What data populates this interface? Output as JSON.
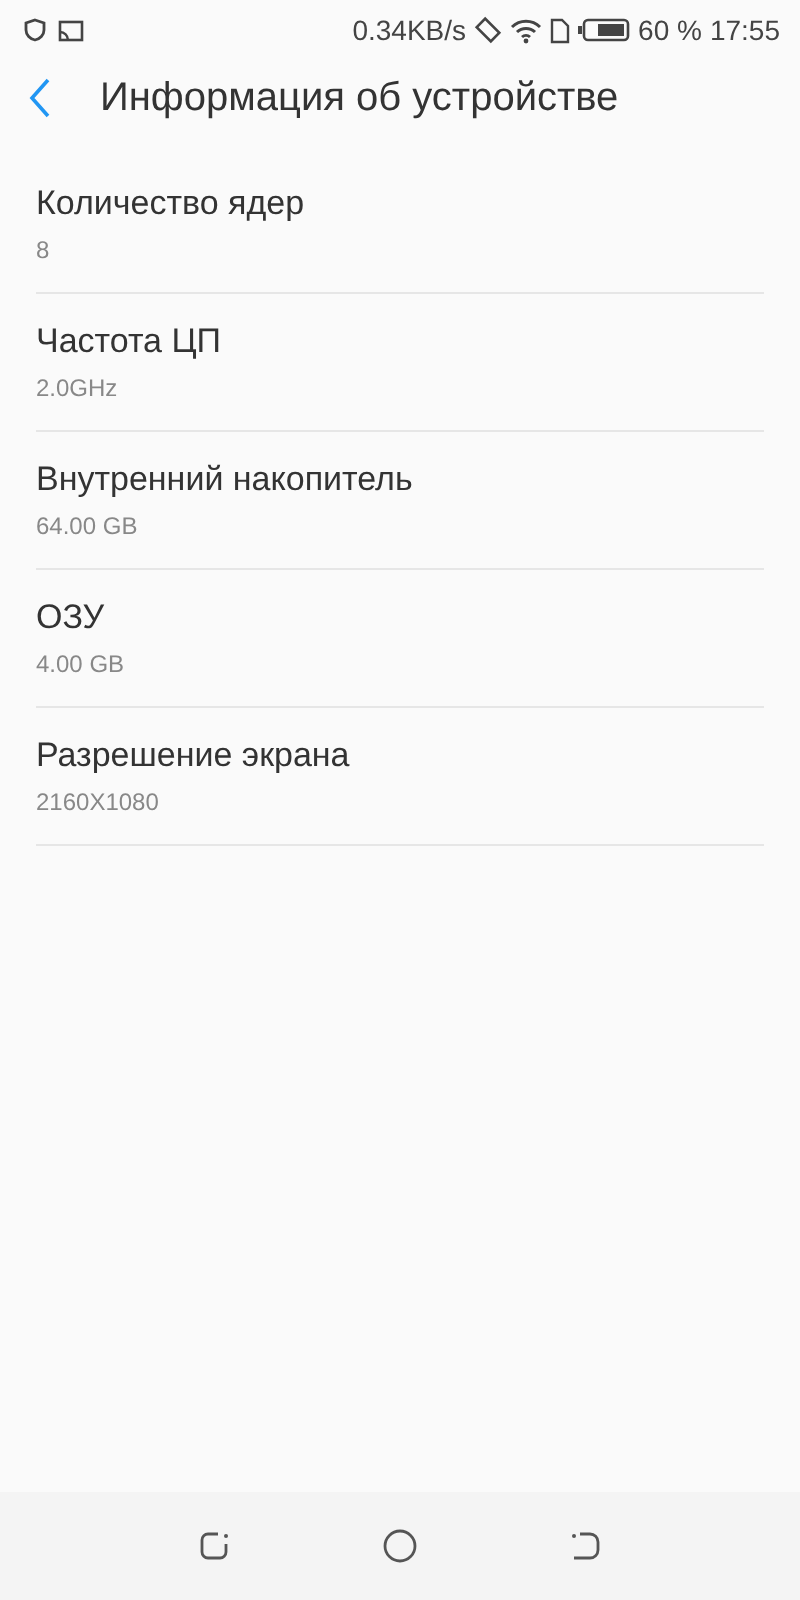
{
  "status_bar": {
    "speed": "0.34KB/s",
    "battery": "60 %",
    "time": "17:55"
  },
  "header": {
    "title": "Информация об устройстве"
  },
  "items": [
    {
      "label": "Количество ядер",
      "value": "8"
    },
    {
      "label": "Частота ЦП",
      "value": "2.0GHz"
    },
    {
      "label": "Внутренний накопитель",
      "value": "64.00 GB"
    },
    {
      "label": "ОЗУ",
      "value": "4.00 GB"
    },
    {
      "label": "Разрешение экрана",
      "value": "2160X1080"
    }
  ]
}
